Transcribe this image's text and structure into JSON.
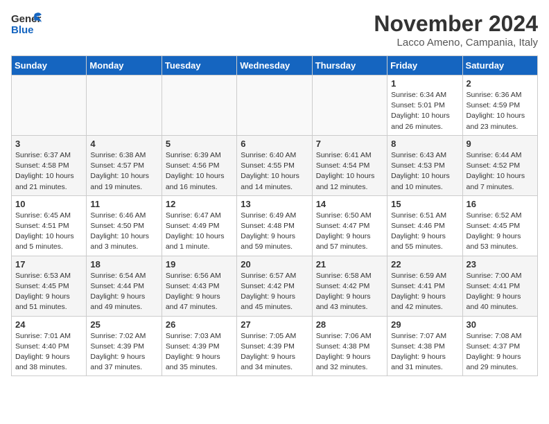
{
  "header": {
    "logo_general": "General",
    "logo_blue": "Blue",
    "title": "November 2024",
    "location": "Lacco Ameno, Campania, Italy"
  },
  "days_of_week": [
    "Sunday",
    "Monday",
    "Tuesday",
    "Wednesday",
    "Thursday",
    "Friday",
    "Saturday"
  ],
  "weeks": [
    [
      {
        "day": "",
        "content": ""
      },
      {
        "day": "",
        "content": ""
      },
      {
        "day": "",
        "content": ""
      },
      {
        "day": "",
        "content": ""
      },
      {
        "day": "",
        "content": ""
      },
      {
        "day": "1",
        "content": "Sunrise: 6:34 AM\nSunset: 5:01 PM\nDaylight: 10 hours and 26 minutes."
      },
      {
        "day": "2",
        "content": "Sunrise: 6:36 AM\nSunset: 4:59 PM\nDaylight: 10 hours and 23 minutes."
      }
    ],
    [
      {
        "day": "3",
        "content": "Sunrise: 6:37 AM\nSunset: 4:58 PM\nDaylight: 10 hours and 21 minutes."
      },
      {
        "day": "4",
        "content": "Sunrise: 6:38 AM\nSunset: 4:57 PM\nDaylight: 10 hours and 19 minutes."
      },
      {
        "day": "5",
        "content": "Sunrise: 6:39 AM\nSunset: 4:56 PM\nDaylight: 10 hours and 16 minutes."
      },
      {
        "day": "6",
        "content": "Sunrise: 6:40 AM\nSunset: 4:55 PM\nDaylight: 10 hours and 14 minutes."
      },
      {
        "day": "7",
        "content": "Sunrise: 6:41 AM\nSunset: 4:54 PM\nDaylight: 10 hours and 12 minutes."
      },
      {
        "day": "8",
        "content": "Sunrise: 6:43 AM\nSunset: 4:53 PM\nDaylight: 10 hours and 10 minutes."
      },
      {
        "day": "9",
        "content": "Sunrise: 6:44 AM\nSunset: 4:52 PM\nDaylight: 10 hours and 7 minutes."
      }
    ],
    [
      {
        "day": "10",
        "content": "Sunrise: 6:45 AM\nSunset: 4:51 PM\nDaylight: 10 hours and 5 minutes."
      },
      {
        "day": "11",
        "content": "Sunrise: 6:46 AM\nSunset: 4:50 PM\nDaylight: 10 hours and 3 minutes."
      },
      {
        "day": "12",
        "content": "Sunrise: 6:47 AM\nSunset: 4:49 PM\nDaylight: 10 hours and 1 minute."
      },
      {
        "day": "13",
        "content": "Sunrise: 6:49 AM\nSunset: 4:48 PM\nDaylight: 9 hours and 59 minutes."
      },
      {
        "day": "14",
        "content": "Sunrise: 6:50 AM\nSunset: 4:47 PM\nDaylight: 9 hours and 57 minutes."
      },
      {
        "day": "15",
        "content": "Sunrise: 6:51 AM\nSunset: 4:46 PM\nDaylight: 9 hours and 55 minutes."
      },
      {
        "day": "16",
        "content": "Sunrise: 6:52 AM\nSunset: 4:45 PM\nDaylight: 9 hours and 53 minutes."
      }
    ],
    [
      {
        "day": "17",
        "content": "Sunrise: 6:53 AM\nSunset: 4:45 PM\nDaylight: 9 hours and 51 minutes."
      },
      {
        "day": "18",
        "content": "Sunrise: 6:54 AM\nSunset: 4:44 PM\nDaylight: 9 hours and 49 minutes."
      },
      {
        "day": "19",
        "content": "Sunrise: 6:56 AM\nSunset: 4:43 PM\nDaylight: 9 hours and 47 minutes."
      },
      {
        "day": "20",
        "content": "Sunrise: 6:57 AM\nSunset: 4:42 PM\nDaylight: 9 hours and 45 minutes."
      },
      {
        "day": "21",
        "content": "Sunrise: 6:58 AM\nSunset: 4:42 PM\nDaylight: 9 hours and 43 minutes."
      },
      {
        "day": "22",
        "content": "Sunrise: 6:59 AM\nSunset: 4:41 PM\nDaylight: 9 hours and 42 minutes."
      },
      {
        "day": "23",
        "content": "Sunrise: 7:00 AM\nSunset: 4:41 PM\nDaylight: 9 hours and 40 minutes."
      }
    ],
    [
      {
        "day": "24",
        "content": "Sunrise: 7:01 AM\nSunset: 4:40 PM\nDaylight: 9 hours and 38 minutes."
      },
      {
        "day": "25",
        "content": "Sunrise: 7:02 AM\nSunset: 4:39 PM\nDaylight: 9 hours and 37 minutes."
      },
      {
        "day": "26",
        "content": "Sunrise: 7:03 AM\nSunset: 4:39 PM\nDaylight: 9 hours and 35 minutes."
      },
      {
        "day": "27",
        "content": "Sunrise: 7:05 AM\nSunset: 4:39 PM\nDaylight: 9 hours and 34 minutes."
      },
      {
        "day": "28",
        "content": "Sunrise: 7:06 AM\nSunset: 4:38 PM\nDaylight: 9 hours and 32 minutes."
      },
      {
        "day": "29",
        "content": "Sunrise: 7:07 AM\nSunset: 4:38 PM\nDaylight: 9 hours and 31 minutes."
      },
      {
        "day": "30",
        "content": "Sunrise: 7:08 AM\nSunset: 4:37 PM\nDaylight: 9 hours and 29 minutes."
      }
    ]
  ]
}
